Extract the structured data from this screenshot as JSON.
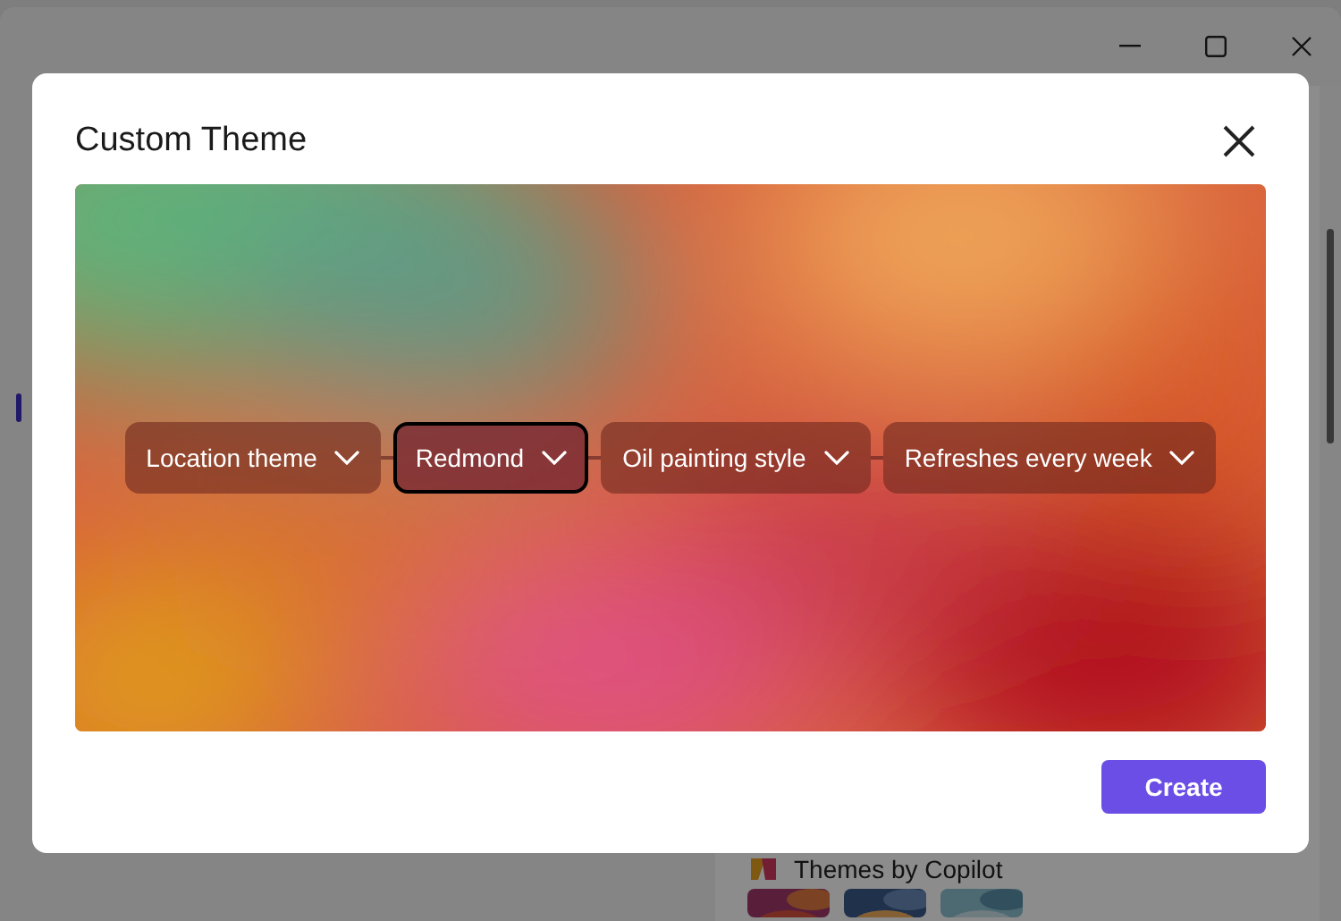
{
  "dialog": {
    "title": "Custom Theme",
    "options": [
      {
        "label": "Location theme",
        "selected": false
      },
      {
        "label": "Redmond",
        "selected": true
      },
      {
        "label": "Oil painting style",
        "selected": false
      },
      {
        "label": "Refreshes every week",
        "selected": false
      }
    ],
    "primary_button": "Create"
  },
  "background": {
    "section_title": "Themes by Copilot"
  }
}
